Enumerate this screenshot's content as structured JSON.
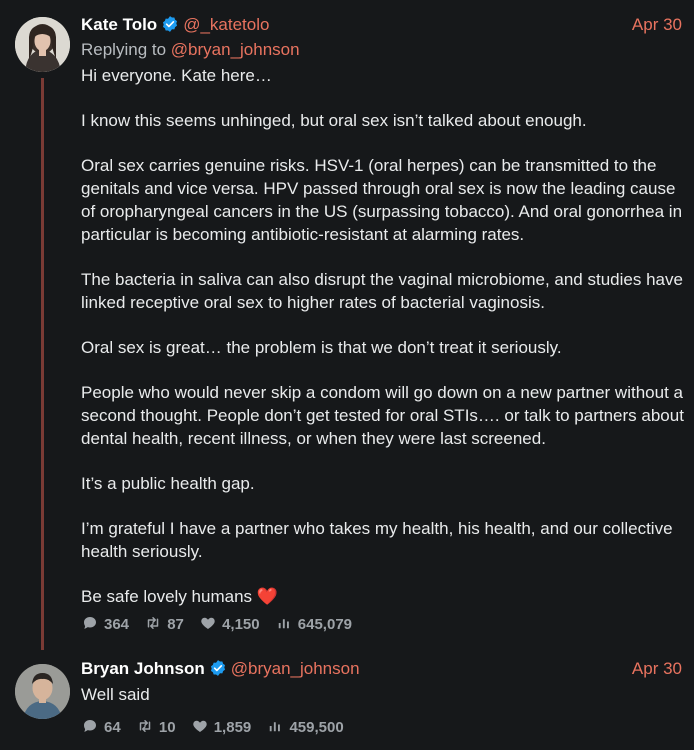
{
  "tweets": [
    {
      "author_name": "Kate Tolo",
      "author_handle": "@_katetolo",
      "date": "Apr 30",
      "replying_prefix": "Replying to",
      "replying_handle": "@bryan_johnson",
      "paragraphs": [
        "Hi everyone. Kate here…",
        "I know this seems unhinged, but oral sex isn’t talked about enough.",
        "Oral sex carries genuine risks. HSV-1 (oral herpes) can be transmitted to the genitals and vice versa. HPV passed through oral sex is now the leading cause of oropharyngeal cancers in the US (surpassing tobacco). And oral gonorrhea in particular is becoming antibiotic-resistant at alarming rates.",
        "The bacteria in saliva can also disrupt the vaginal microbiome, and studies have linked receptive oral sex to higher rates of bacterial vaginosis.",
        "Oral sex is great… the problem is that we don’t treat it seriously.",
        "People who would never skip a condom will go down on a new partner without a second thought. People don’t get tested for oral STIs…. or talk to partners about dental health, recent illness, or when they were last screened.",
        "It’s a public health gap.",
        "I’m grateful I have a partner who takes my health, his health, and our collective health seriously.",
        "Be safe lovely humans"
      ],
      "closing_emoji": "❤️",
      "replies": "364",
      "retweets": "87",
      "likes": "4,150",
      "views": "645,079"
    },
    {
      "author_name": "Bryan Johnson",
      "author_handle": "@bryan_johnson",
      "date": "Apr 30",
      "text": "Well said",
      "replies": "64",
      "retweets": "10",
      "likes": "1,859",
      "views": "459,500"
    }
  ],
  "colors": {
    "background": "#16181a",
    "accent": "#e8735f",
    "thread_line": "#7a3b35",
    "verified": "#1d9bf0",
    "muted": "#9ea3a8"
  },
  "icons": [
    "reply-icon",
    "retweet-icon",
    "like-icon",
    "views-icon",
    "verified-badge-icon"
  ]
}
